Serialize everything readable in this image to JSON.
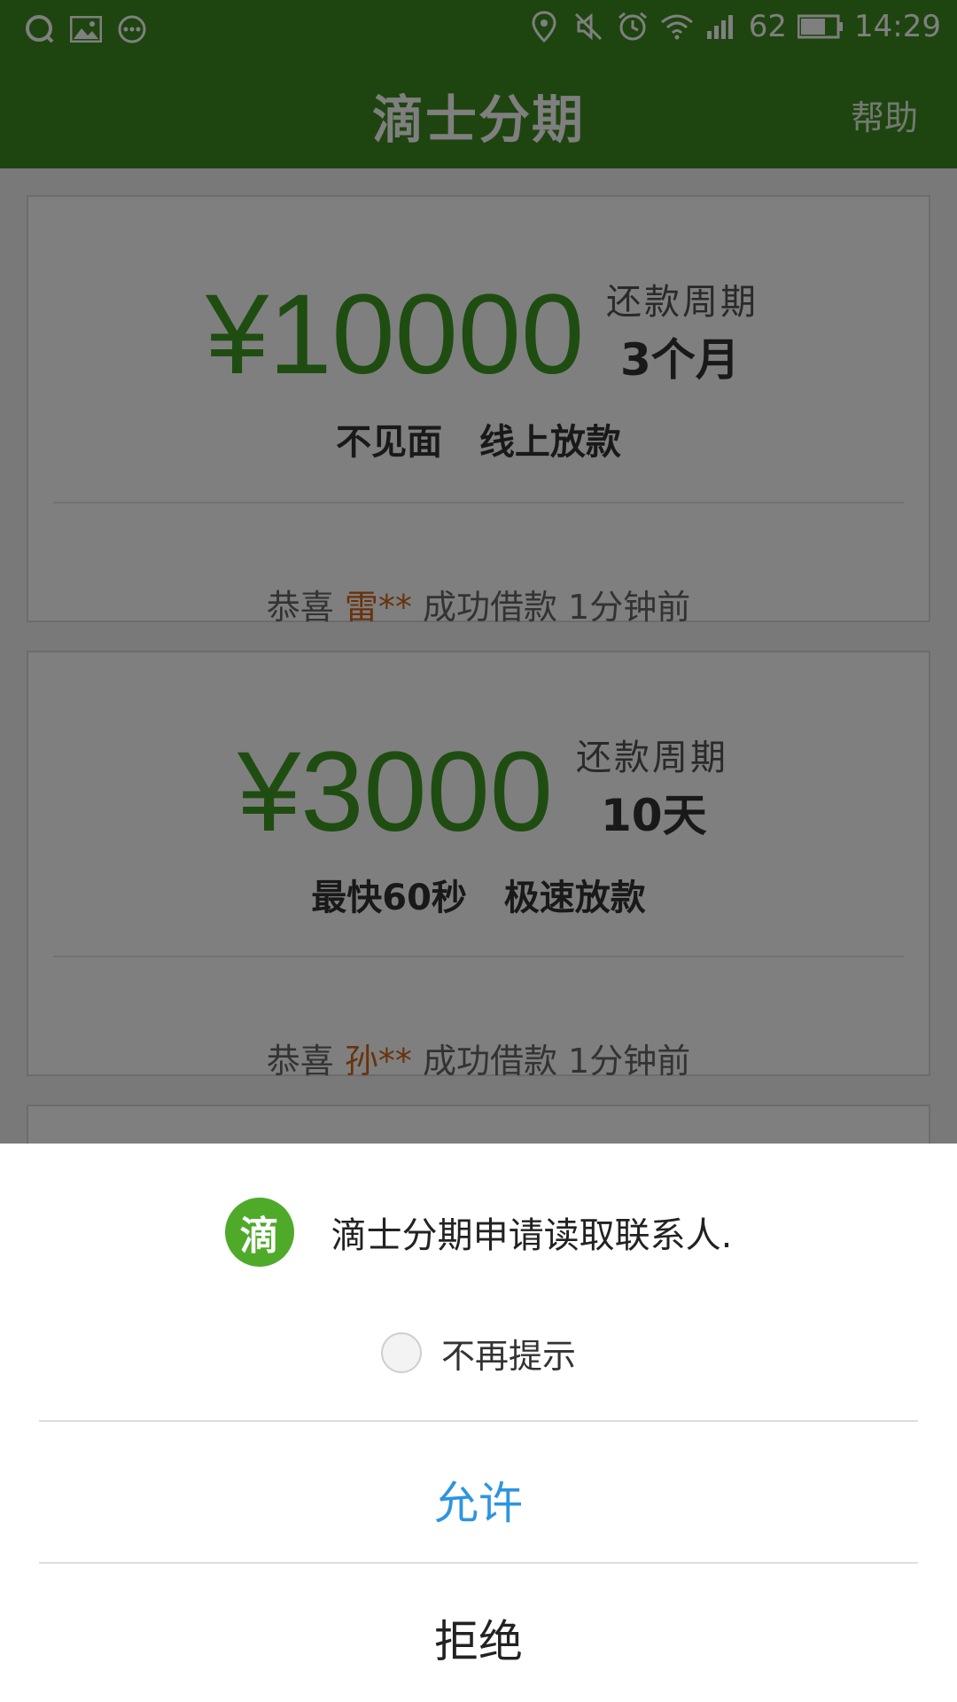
{
  "status_bar": {
    "battery": "62",
    "time": "14:29",
    "icons": [
      "qq-icon",
      "gallery-icon",
      "more-icon",
      "location-icon",
      "mute-icon",
      "alarm-icon",
      "wifi-icon",
      "signal-icon",
      "battery-icon"
    ]
  },
  "app_bar": {
    "title": "滴士分期",
    "help": "帮助"
  },
  "cards": [
    {
      "amount": "¥10000",
      "term_label": "还款周期",
      "term_value": "3个月",
      "feature": "不见面   线上放款",
      "ticker_prefix": "恭喜 ",
      "ticker_name": "雷**",
      "ticker_suffix": " 成功借款 1分钟前"
    },
    {
      "amount": "¥3000",
      "term_label": "还款周期",
      "term_value": "10天",
      "feature": "最快60秒   极速放款",
      "ticker_prefix": "恭喜 ",
      "ticker_name": "孙**",
      "ticker_suffix": " 成功借款 1分钟前"
    }
  ],
  "permission_dialog": {
    "app_icon_glyph": "滴",
    "message": "滴士分期申请读取联系人.",
    "dont_ask_label": "不再提示",
    "allow_label": "允许",
    "deny_label": "拒绝"
  },
  "colors": {
    "brand_green": "#3d8b1f",
    "amount_green": "#3f9a22",
    "name_orange": "#d0641c",
    "allow_blue": "#2d95e0"
  }
}
